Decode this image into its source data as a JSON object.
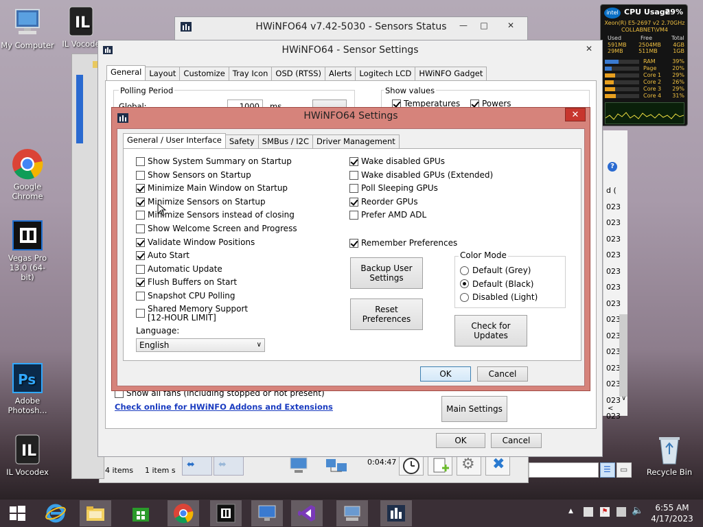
{
  "desktop": {
    "icons": [
      {
        "label": "My Computer"
      },
      {
        "label": "IL Vocode"
      },
      {
        "label": "Google Chrome"
      },
      {
        "label": "Vegas Pro 13.0 (64-bit)"
      },
      {
        "label": "Adobe Photosh..."
      },
      {
        "label": "IL Vocodex"
      },
      {
        "label": "Recycle Bin"
      }
    ]
  },
  "gadget": {
    "brand": "intel",
    "title": "CPU Usage",
    "percent": "29%",
    "cpu_line1": "Xeon(R) E5-2697 v2 2.70GHz",
    "cpu_line2": "COLLABNET\\VM4",
    "headers": [
      "Used",
      "Free",
      "Total"
    ],
    "rows": [
      [
        "591MB",
        "2504MB",
        "4GB"
      ],
      [
        "29MB",
        "511MB",
        "1GB"
      ]
    ],
    "bars": [
      {
        "label": "RAM",
        "value": "39%",
        "level": 0.39
      },
      {
        "label": "Page",
        "value": "20%",
        "level": 0.2
      },
      {
        "label": "Core 1",
        "value": "29%",
        "level": 0.29
      },
      {
        "label": "Core 2",
        "value": "26%",
        "level": 0.26
      },
      {
        "label": "Core 3",
        "value": "29%",
        "level": 0.29
      },
      {
        "label": "Core 4",
        "value": "31%",
        "level": 0.31
      }
    ]
  },
  "sensors_window": {
    "title": "HWiNFO64 v7.42-5030 - Sensors Status",
    "status_items": "4 items",
    "status_selected": "1 item s",
    "timer": "0:04:47",
    "right_col": [
      "d (",
      "023",
      "023",
      "023",
      "023",
      "023",
      "023",
      "023",
      "023",
      "023",
      "023",
      "023",
      "023",
      "023",
      "023"
    ]
  },
  "sensor_settings": {
    "title": "HWiNFO64 - Sensor Settings",
    "tabs": [
      "General",
      "Layout",
      "Customize",
      "Tray Icon",
      "OSD (RTSS)",
      "Alerts",
      "Logitech LCD",
      "HWiNFO Gadget"
    ],
    "polling_period": "Polling Period",
    "global_label": "Global:",
    "global_value": "1000",
    "global_unit": "ms",
    "show_values": "Show values",
    "temperatures": "Temperatures",
    "powers": "Powers",
    "show_all_fans": "Show all fans (including stopped or not present)",
    "addons_link": "Check online for HWiNFO Addons and Extensions",
    "main_settings": "Main Settings",
    "ok": "OK",
    "cancel": "Cancel"
  },
  "settings_dialog": {
    "title": "HWiNFO64 Settings",
    "tabs": [
      "General / User Interface",
      "Safety",
      "SMBus / I2C",
      "Driver Management"
    ],
    "left_options": [
      {
        "label": "Show System Summary on Startup",
        "checked": false
      },
      {
        "label": "Show Sensors on Startup",
        "checked": false
      },
      {
        "label": "Minimize Main Window on Startup",
        "checked": true
      },
      {
        "label": "Minimize Sensors on Startup",
        "checked": true
      },
      {
        "label": "Minimize Sensors instead of closing",
        "checked": false
      },
      {
        "label": "Show Welcome Screen and Progress",
        "checked": false
      },
      {
        "label": "Validate Window Positions",
        "checked": true
      },
      {
        "label": "Auto Start",
        "checked": true
      },
      {
        "label": "Automatic Update",
        "checked": false
      },
      {
        "label": "Flush Buffers on Start",
        "checked": true
      },
      {
        "label": "Snapshot CPU Polling",
        "checked": false
      }
    ],
    "shared_memory_line1": "Shared Memory Support",
    "shared_memory_line2": "[12-HOUR LIMIT]",
    "shared_memory_checked": false,
    "right_options": [
      {
        "label": "Wake disabled GPUs",
        "checked": true
      },
      {
        "label": "Wake disabled GPUs (Extended)",
        "checked": false
      },
      {
        "label": "Poll Sleeping GPUs",
        "checked": false
      },
      {
        "label": "Reorder GPUs",
        "checked": true
      },
      {
        "label": "Prefer AMD ADL",
        "checked": false
      }
    ],
    "remember_preferences": "Remember Preferences",
    "remember_checked": true,
    "language_label": "Language:",
    "language_value": "English",
    "backup_line1": "Backup User",
    "backup_line2": "Settings",
    "reset_preferences": "Reset Preferences",
    "check_updates": "Check for Updates",
    "color_mode": "Color Mode",
    "color_options": [
      {
        "label": "Default (Grey)",
        "selected": false
      },
      {
        "label": "Default (Black)",
        "selected": true
      },
      {
        "label": "Disabled (Light)",
        "selected": false
      }
    ],
    "ok": "OK",
    "cancel": "Cancel"
  },
  "taskbar": {
    "time": "6:55 AM",
    "date": "4/17/2023"
  }
}
